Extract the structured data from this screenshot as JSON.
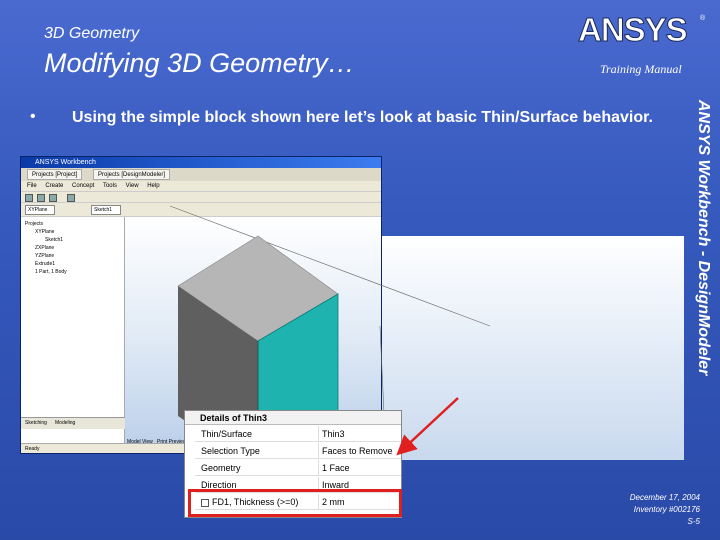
{
  "slide": {
    "subtitle": "3D Geometry",
    "title": "Modifying 3D Geometry…",
    "training_manual": "Training Manual",
    "sidebar": "ANSYS Workbench - DesignModeler",
    "bullet": "Using the simple block shown here let’s look at basic Thin/Surface behavior.",
    "logo_text": "ANSYS",
    "footer": {
      "date": "December 17, 2004",
      "inventory": "Inventory #002176",
      "page": "S-5"
    },
    "colors": {
      "background": "#3559bd",
      "highlight": "#e02020",
      "face_selected": "#1fb3b0"
    }
  },
  "workbench": {
    "title": "ANSYS Workbench",
    "tabs": [
      "Projects [Project]",
      "Projects [DesignModeler]"
    ],
    "menu": [
      "File",
      "Create",
      "Concept",
      "Tools",
      "View",
      "Help"
    ],
    "plane_select": "XYPlane",
    "sketch_select": "Sketch1",
    "tree": [
      "Projects",
      "XYPlane",
      "Sketch1",
      "ZXPlane",
      "YZPlane",
      "Extrude1",
      "1 Part, 1 Body"
    ],
    "tree_tabs": [
      "Sketching",
      "Modeling"
    ],
    "bottom_tabs": [
      "Model View",
      "Print Preview"
    ],
    "status": "Ready"
  },
  "details": {
    "title": "Details of Thin3",
    "rows": [
      {
        "key": "Thin/Surface",
        "value": "Thin3"
      },
      {
        "key": "Selection Type",
        "value": "Faces to Remove"
      },
      {
        "key": "Geometry",
        "value": "1 Face"
      },
      {
        "key": "Direction",
        "value": "Inward"
      },
      {
        "key": "FD1, Thickness (>=0)",
        "value": "2 mm"
      }
    ]
  }
}
